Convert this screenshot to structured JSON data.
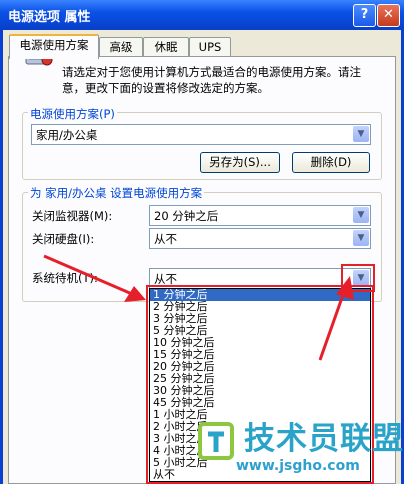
{
  "window": {
    "title": "电源选项 属性",
    "help_button": "?",
    "close_button": "✕"
  },
  "tabs": [
    {
      "label": "电源使用方案"
    },
    {
      "label": "高级"
    },
    {
      "label": "休眠"
    },
    {
      "label": "UPS"
    }
  ],
  "intro": {
    "text": "请选定对于您使用计算机方式最适合的电源使用方案。请注意，更改下面的设置将修改选定的方案。"
  },
  "scheme": {
    "group_label": "电源使用方案(P)",
    "selected": "家用/办公桌",
    "save_as": "另存为(S)...",
    "delete": "删除(D)"
  },
  "settings": {
    "group_label": "为 家用/办公桌 设置电源使用方案",
    "monitor_label": "关闭监视器(M):",
    "monitor_value": "20 分钟之后",
    "disk_label": "关闭硬盘(I):",
    "disk_value": "从不",
    "standby_label": "系统待机(T):",
    "standby_value": "从不"
  },
  "dropdown_items": [
    "1 分钟之后",
    "2 分钟之后",
    "3 分钟之后",
    "5 分钟之后",
    "10 分钟之后",
    "15 分钟之后",
    "20 分钟之后",
    "25 分钟之后",
    "30 分钟之后",
    "45 分钟之后",
    "1 小时之后",
    "2 小时之后",
    "3 小时之后",
    "4 小时之后",
    "5 小时之后",
    "从不"
  ],
  "dropdown_selected_index": 0,
  "watermark": {
    "text": "技术员联盟",
    "url": "www.jsgho.com"
  },
  "colors": {
    "title_bar": "#0a52e6",
    "selection": "#316ac5",
    "highlight_red": "#e5202a",
    "group_label_blue": "#0046d5"
  }
}
